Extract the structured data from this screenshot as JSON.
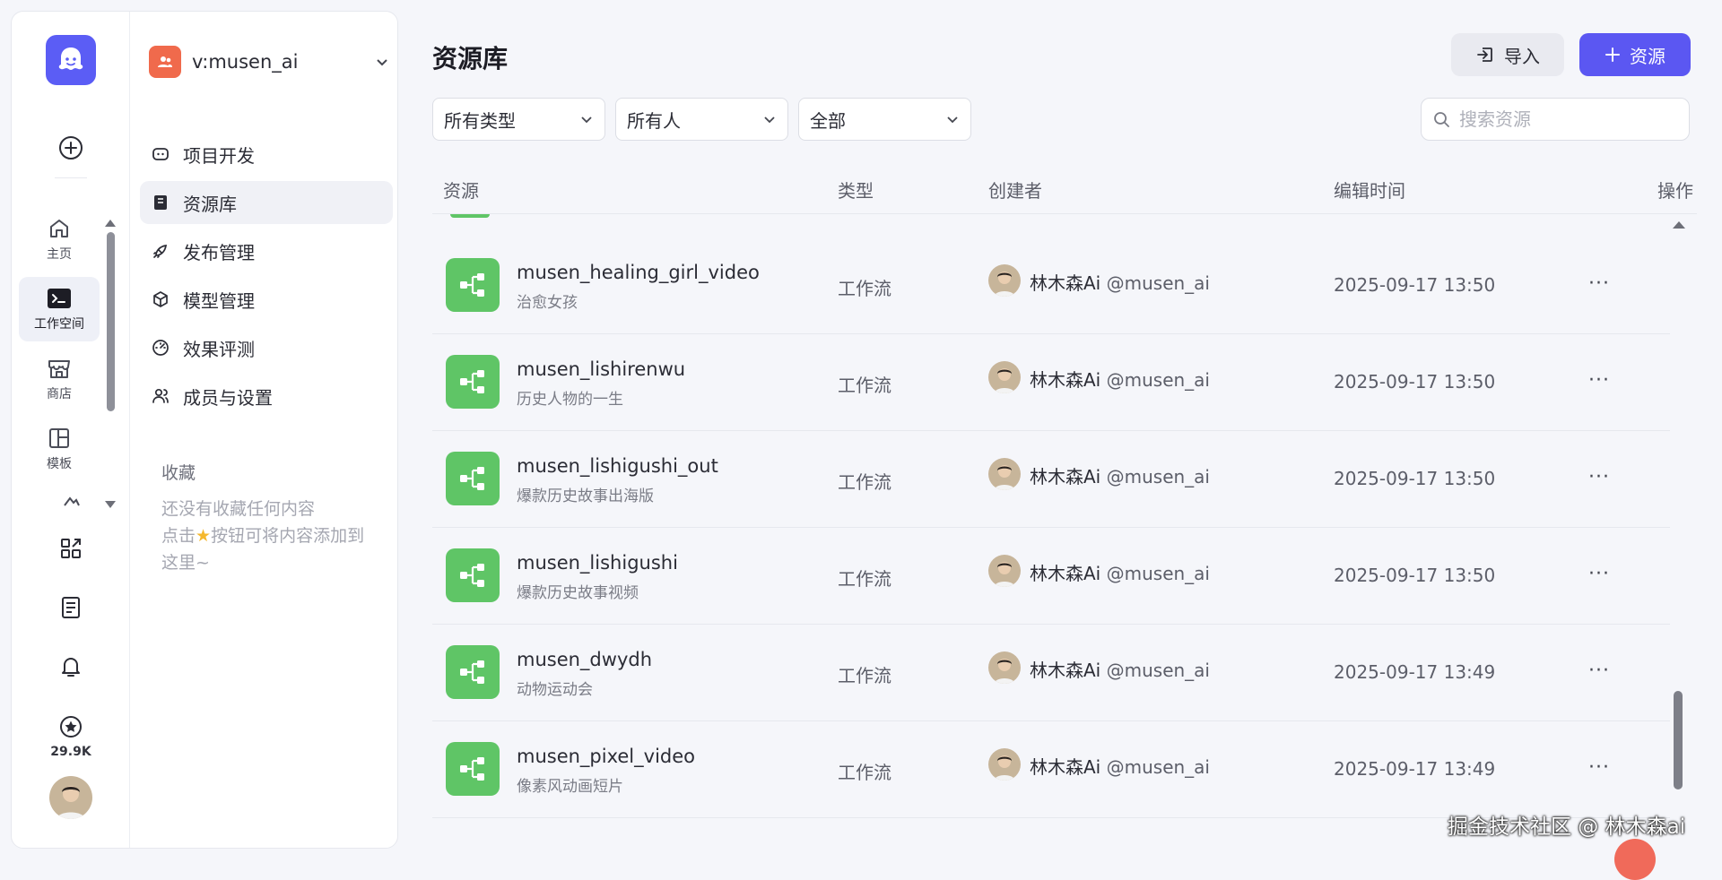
{
  "sidebar": {
    "rail": {
      "items": [
        {
          "icon": "home-icon",
          "label": "主页"
        },
        {
          "icon": "workspace-icon",
          "label": "工作空间"
        },
        {
          "icon": "store-icon",
          "label": "商店"
        },
        {
          "icon": "template-icon",
          "label": "模板"
        }
      ],
      "star_count": "29.9K"
    },
    "workspace": {
      "name": "v:musen_ai"
    },
    "nav": [
      {
        "label": "项目开发",
        "icon": "project-icon"
      },
      {
        "label": "资源库",
        "icon": "library-icon",
        "active": true
      },
      {
        "label": "发布管理",
        "icon": "rocket-icon"
      },
      {
        "label": "模型管理",
        "icon": "model-icon"
      },
      {
        "label": "效果评测",
        "icon": "gauge-icon"
      },
      {
        "label": "成员与设置",
        "icon": "members-icon"
      }
    ],
    "favorites": {
      "title": "收藏",
      "empty_line1": "还没有收藏任何内容",
      "empty_line2_prefix": "点击",
      "empty_line2_suffix": "按钮可将内容添加到",
      "empty_line3": "这里~"
    }
  },
  "main": {
    "title": "资源库",
    "import_label": "导入",
    "add_label": "资源",
    "filters": [
      {
        "value": "所有类型"
      },
      {
        "value": "所有人"
      },
      {
        "value": "全部"
      }
    ],
    "search_placeholder": "搜索资源",
    "columns": [
      "资源",
      "类型",
      "创建者",
      "编辑时间",
      "操作"
    ],
    "rows": [
      {
        "name": "musen_healing_girl_video",
        "desc": "治愈女孩",
        "type": "工作流",
        "creator": "林木森Ai",
        "handle": "@musen_ai",
        "time": "2025-09-17 13:50"
      },
      {
        "name": "musen_lishirenwu",
        "desc": "历史人物的一生",
        "type": "工作流",
        "creator": "林木森Ai",
        "handle": "@musen_ai",
        "time": "2025-09-17 13:50"
      },
      {
        "name": "musen_lishigushi_out",
        "desc": "爆款历史故事出海版",
        "type": "工作流",
        "creator": "林木森Ai",
        "handle": "@musen_ai",
        "time": "2025-09-17 13:50"
      },
      {
        "name": "musen_lishigushi",
        "desc": "爆款历史故事视频",
        "type": "工作流",
        "creator": "林木森Ai",
        "handle": "@musen_ai",
        "time": "2025-09-17 13:50"
      },
      {
        "name": "musen_dwydh",
        "desc": "动物运动会",
        "type": "工作流",
        "creator": "林木森Ai",
        "handle": "@musen_ai",
        "time": "2025-09-17 13:49"
      },
      {
        "name": "musen_pixel_video",
        "desc": "像素风动画短片",
        "type": "工作流",
        "creator": "林木森Ai",
        "handle": "@musen_ai",
        "time": "2025-09-17 13:49"
      }
    ]
  },
  "watermark": "掘金技术社区 @ 林木森ai",
  "colors": {
    "accent": "#5b57f2",
    "workflow": "#5fc566",
    "workspace_badge": "#f06a4c"
  }
}
